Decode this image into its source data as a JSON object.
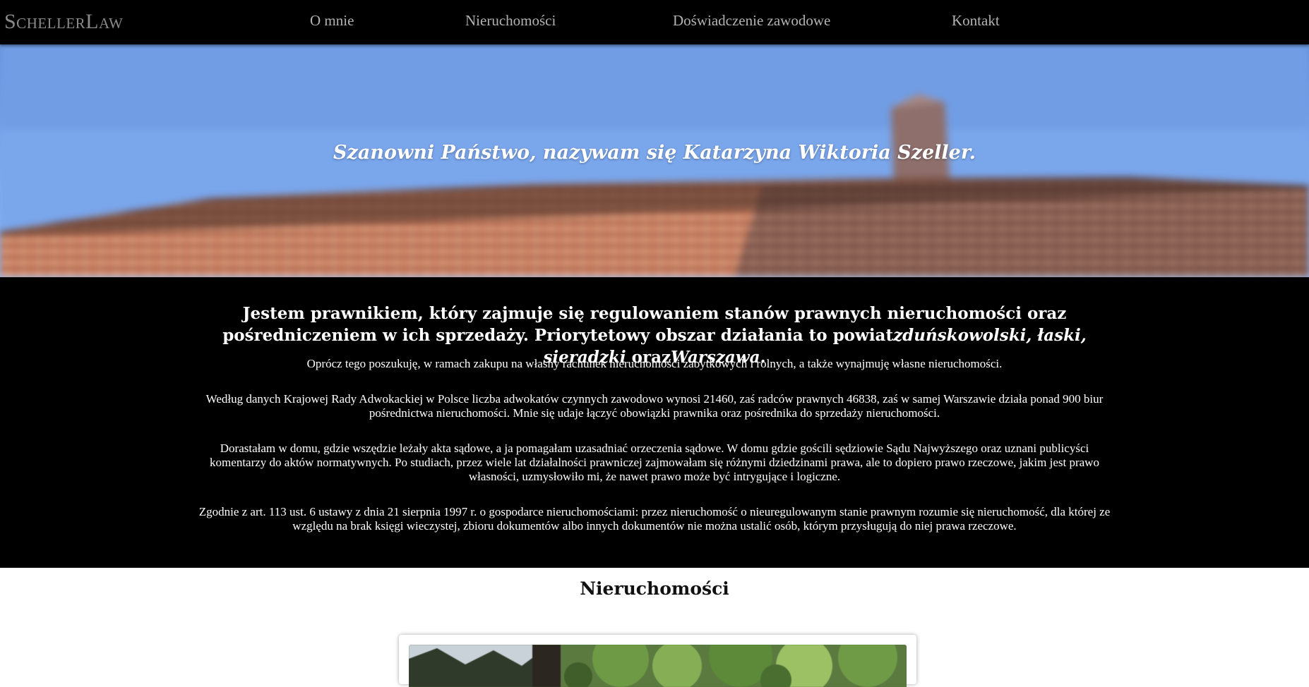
{
  "nav": {
    "logo": "SchellerLaw",
    "links": [
      "O mnie",
      "Nieruchomości",
      "Doświadczenie zawodowe",
      "Kontakt"
    ]
  },
  "hero": {
    "title": "Szanowni Państwo, nazywam się Katarzyna Wiktoria Szeller."
  },
  "about": {
    "lead_text": "Jestem prawnikiem, który zajmuje się regulowaniem stanów prawnych nieruchomości oraz pośredniczeniem w ich sprzedaży. Priorytetowy obszar działania to powiat",
    "lead_counties": "zduńskowolski, łaski, sieradzki",
    "lead_and": " oraz",
    "lead_city": "Warszawa.",
    "paragraphs": [
      "Oprócz tego poszukuję, w ramach zakupu na własny rachunek nieruchomości zabytkowych i rolnych, a także wynajmuję własne nieruchomości.",
      "Według danych Krajowej Rady Adwokackiej w Polsce liczba adwokatów czynnych zawodowo wynosi 21460, zaś radców prawnych 46838, zaś w samej Warszawie działa ponad 900 biur pośrednictwa nieruchomości. Mnie się udaje łączyć obowiązki prawnika oraz pośrednika do sprzedaży nieruchomości.",
      "Dorastałam w domu, gdzie wszędzie leżały akta sądowe, a ja pomagałam uzasadniać orzeczenia sądowe. W domu gdzie gościli sędziowie Sądu Najwyższego oraz uznani publicyści komentarzy do aktów normatywnych. Po studiach, przez wiele lat działalności prawniczej zajmowałam się różnymi dziedzinami prawa, ale to dopiero prawo rzeczowe, jakim jest prawo własności, uzmysłowiło mi, że nawet prawo może być intrygujące i logiczne.",
      "Zgodnie z art. 113 ust. 6 ustawy z dnia 21 sierpnia 1997 r. o gospodarce nieruchomościami: przez nieruchomość o nieuregulowanym stanie prawnym rozumie się nieruchomość, dla której ze względu na brak księgi wieczystej, zbioru dokumentów albo innych dokumentów nie można ustalić osób, którym przysługują do niej prawa rzeczowe."
    ]
  },
  "properties": {
    "title": "Nieruchomości"
  },
  "colors": {
    "nav_bg": "#000000",
    "nav_text": "#b3b3b3",
    "logo": "#8a8a8a",
    "about_bg": "#000000",
    "about_text": "#ffffff"
  }
}
